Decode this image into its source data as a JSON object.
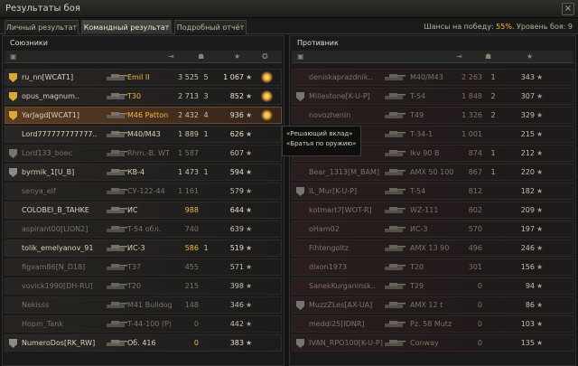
{
  "window": {
    "title": "Результаты боя",
    "close_label": "×"
  },
  "tabs": [
    {
      "label": "Личный результат",
      "active": false
    },
    {
      "label": "Командный результат",
      "active": true
    },
    {
      "label": "Подробный отчёт",
      "active": false
    }
  ],
  "chance": {
    "prefix": "Шансы на победу:",
    "value": "55%",
    "level": "Уровень боя: 9"
  },
  "allies": {
    "title": "Союзники",
    "rows": [
      {
        "badge": "yellow",
        "name": "ru_nn[WCAT1]",
        "tank": "Emil II",
        "tank_gold": true,
        "dmg": "3 525",
        "kills": "5",
        "xp": "1 067",
        "star": "★",
        "medal": true,
        "dead": false,
        "me": false
      },
      {
        "badge": "yellow",
        "name": "opus_magnum..",
        "tank": "T30",
        "tank_gold": true,
        "dmg": "2 713",
        "kills": "3",
        "xp": "852",
        "star": "★",
        "medal": true,
        "dead": false,
        "me": false
      },
      {
        "badge": "yellow",
        "name": "YarJagd[WCAT1]",
        "tank": "M46 Patton",
        "tank_gold": true,
        "dmg": "2 432",
        "kills": "4",
        "xp": "936",
        "star": "★",
        "medal": true,
        "dead": false,
        "me": true
      },
      {
        "badge": "",
        "name": "Lord777777777777..",
        "tank": "M40/M43",
        "tank_gold": false,
        "dmg": "1 889",
        "kills": "1",
        "xp": "626",
        "star": "★",
        "medal": false,
        "dead": false,
        "me": false
      },
      {
        "badge": "grey",
        "name": "Lord133_boec",
        "tank": "Rhm.-B. WT",
        "tank_gold": false,
        "dmg": "1 587",
        "kills": "",
        "xp": "607",
        "star": "★",
        "medal": false,
        "dead": true,
        "me": false
      },
      {
        "badge": "grey",
        "name": "byrmik_1[U_B]",
        "tank": "КВ-4",
        "tank_gold": false,
        "dmg": "1 473",
        "kills": "1",
        "xp": "594",
        "star": "★",
        "medal": false,
        "dead": false,
        "me": false
      },
      {
        "badge": "",
        "name": "senya_elf",
        "tank": "СУ-122-44",
        "tank_gold": false,
        "dmg": "1 161",
        "kills": "",
        "xp": "579",
        "star": "★",
        "medal": false,
        "dead": true,
        "me": false
      },
      {
        "badge": "",
        "name": "COLOBEI_B_TAHKE",
        "tank": "ИС",
        "tank_gold": false,
        "dmg": "988",
        "kills": "",
        "xp": "644",
        "star": "★",
        "medal": false,
        "dead": false,
        "me": false,
        "dmg_gold": true
      },
      {
        "badge": "",
        "name": "aspirant00[LION2]",
        "tank": "T-54 обл.",
        "tank_gold": false,
        "dmg": "740",
        "kills": "",
        "xp": "639",
        "star": "★",
        "medal": false,
        "dead": true,
        "me": false
      },
      {
        "badge": "",
        "name": "tolik_emelyanov_91",
        "tank": "ИС-3",
        "tank_gold": false,
        "dmg": "586",
        "kills": "1",
        "xp": "519",
        "star": "★",
        "medal": false,
        "dead": false,
        "me": false,
        "dmg_gold": true
      },
      {
        "badge": "",
        "name": "figvam86[N_D18]",
        "tank": "T37",
        "tank_gold": false,
        "dmg": "455",
        "kills": "",
        "xp": "571",
        "star": "★",
        "medal": false,
        "dead": true,
        "me": false
      },
      {
        "badge": "",
        "name": "vovick1990[DH-RU]",
        "tank": "T20",
        "tank_gold": false,
        "dmg": "215",
        "kills": "",
        "xp": "398",
        "star": "★",
        "medal": false,
        "dead": true,
        "me": false
      },
      {
        "badge": "",
        "name": "Nekisss",
        "tank": "M41 Bulldog",
        "tank_gold": false,
        "dmg": "148",
        "kills": "",
        "xp": "346",
        "star": "★",
        "medal": false,
        "dead": true,
        "me": false
      },
      {
        "badge": "",
        "name": "Hopm_Tank",
        "tank": "T-44-100 (P)",
        "tank_gold": false,
        "dmg": "0",
        "kills": "",
        "xp": "442",
        "star": "★",
        "medal": false,
        "dead": true,
        "me": false
      },
      {
        "badge": "grey",
        "name": "NumeroDos[RK_RW]",
        "tank": "Об. 416",
        "tank_gold": false,
        "dmg": "0",
        "kills": "",
        "xp": "383",
        "star": "★",
        "medal": false,
        "dead": false,
        "me": false,
        "dmg_gold": true
      }
    ]
  },
  "enemies": {
    "title": "Противник",
    "rows": [
      {
        "badge": "",
        "name": "deniskaprazdnik..",
        "tank": "M40/M43",
        "dmg": "2 263",
        "kills": "1",
        "xp": "343",
        "star": "★",
        "dead": true
      },
      {
        "badge": "grey",
        "name": "Millestone[K-U-P]",
        "tank": "T-54",
        "dmg": "1 848",
        "kills": "2",
        "xp": "307",
        "star": "★",
        "dead": true
      },
      {
        "badge": "",
        "name": "novozhenin",
        "tank": "T49",
        "dmg": "1 326",
        "kills": "2",
        "xp": "329",
        "star": "★",
        "dead": true
      },
      {
        "badge": "",
        "name": "",
        "tank": "T-34-1",
        "dmg": "1 001",
        "kills": "",
        "xp": "215",
        "star": "★",
        "dead": true
      },
      {
        "badge": "",
        "name": "",
        "tank": "Ikv 90 B",
        "dmg": "874",
        "kills": "1",
        "xp": "212",
        "star": "★",
        "dead": true
      },
      {
        "badge": "",
        "name": "Bear_1313[M_BAM]",
        "tank": "AMX 50 100",
        "dmg": "867",
        "kills": "1",
        "xp": "220",
        "star": "★",
        "dead": true
      },
      {
        "badge": "grey",
        "name": "IL_Mur[K-U-P]",
        "tank": "T-54",
        "dmg": "812",
        "kills": "",
        "xp": "182",
        "star": "★",
        "dead": true
      },
      {
        "badge": "",
        "name": "kotmart7[WOT-R]",
        "tank": "WZ-111",
        "dmg": "802",
        "kills": "",
        "xp": "209",
        "star": "★",
        "dead": true
      },
      {
        "badge": "",
        "name": "oHam02",
        "tank": "ИС-3",
        "dmg": "570",
        "kills": "",
        "xp": "197",
        "star": "★",
        "dead": true
      },
      {
        "badge": "",
        "name": "Fihtengoltz",
        "tank": "AMX 13 90",
        "dmg": "496",
        "kills": "",
        "xp": "246",
        "star": "★",
        "dead": true
      },
      {
        "badge": "",
        "name": "dixon1973",
        "tank": "T20",
        "dmg": "301",
        "kills": "",
        "xp": "156",
        "star": "★",
        "dead": true
      },
      {
        "badge": "",
        "name": "SanekKurganinsk..",
        "tank": "T29",
        "dmg": "0",
        "kills": "",
        "xp": "94",
        "star": "★",
        "dead": true
      },
      {
        "badge": "grey",
        "name": "MuzzZLes[AX-UA]",
        "tank": "AMX 12 t",
        "dmg": "0",
        "kills": "",
        "xp": "86",
        "star": "★",
        "dead": true
      },
      {
        "badge": "",
        "name": "meddi25[IDNR]",
        "tank": "Pz. 58 Mutz",
        "dmg": "0",
        "kills": "",
        "xp": "103",
        "star": "★",
        "dead": true
      },
      {
        "badge": "grey",
        "name": "IVAN_RPO100[K-U-P]",
        "tank": "Conway",
        "dmg": "0",
        "kills": "",
        "xp": "135",
        "star": "★",
        "dead": true
      }
    ]
  },
  "tooltip": {
    "line1": "«Решающий вклад»",
    "line2": "«Братья по оружию»"
  },
  "colors": {
    "accent": "#f0b840",
    "ally_bg": "#2a2623",
    "enemy_bg": "#2f1e1e",
    "me_bg": "#5c3c22"
  }
}
